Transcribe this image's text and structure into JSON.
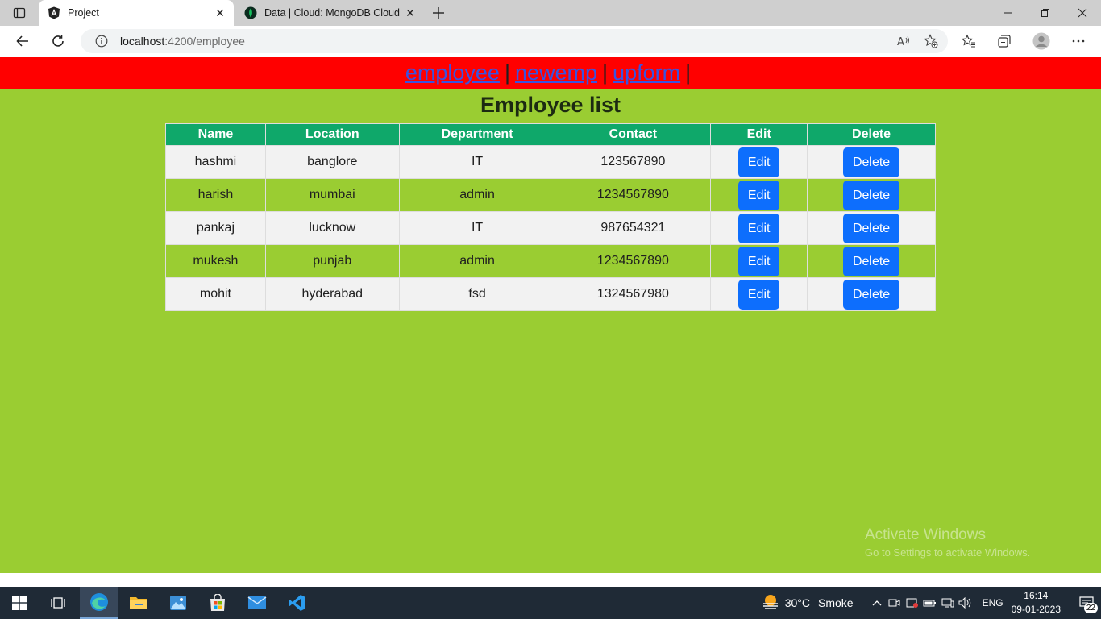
{
  "browser": {
    "tabs": [
      {
        "title": "Project",
        "active": true,
        "icon": "angular-icon"
      },
      {
        "title": "Data | Cloud: MongoDB Cloud",
        "active": false,
        "icon": "mongodb-leaf-icon"
      }
    ],
    "url_host": "localhost",
    "url_path": ":4200/employee"
  },
  "nav": {
    "links": [
      "employee",
      "newemp",
      "upform"
    ],
    "separator": "|"
  },
  "page": {
    "title": "Employee list"
  },
  "table": {
    "headers": [
      "Name",
      "Location",
      "Department",
      "Contact",
      "Edit",
      "Delete"
    ],
    "rows": [
      {
        "name": "hashmi",
        "location": "banglore",
        "department": "IT",
        "contact": "123567890"
      },
      {
        "name": "harish",
        "location": "mumbai",
        "department": "admin",
        "contact": "1234567890"
      },
      {
        "name": "pankaj",
        "location": "lucknow",
        "department": "IT",
        "contact": "987654321"
      },
      {
        "name": "mukesh",
        "location": "punjab",
        "department": "admin",
        "contact": "1234567890"
      },
      {
        "name": "mohit",
        "location": "hyderabad",
        "department": "fsd",
        "contact": "1324567980"
      }
    ],
    "edit_label": "Edit",
    "delete_label": "Delete"
  },
  "watermark": {
    "line1": "Activate Windows",
    "line2": "Go to Settings to activate Windows."
  },
  "taskbar": {
    "temperature": "30°C",
    "weather_text": "Smoke",
    "language": "ENG",
    "time": "16:14",
    "date": "09-01-2023",
    "notification_count": "22"
  },
  "colors": {
    "nav_bg": "#ff0000",
    "page_bg": "#9acd32",
    "table_header": "#0fa86a",
    "button": "#0d6efd",
    "link": "#3a53e0"
  }
}
